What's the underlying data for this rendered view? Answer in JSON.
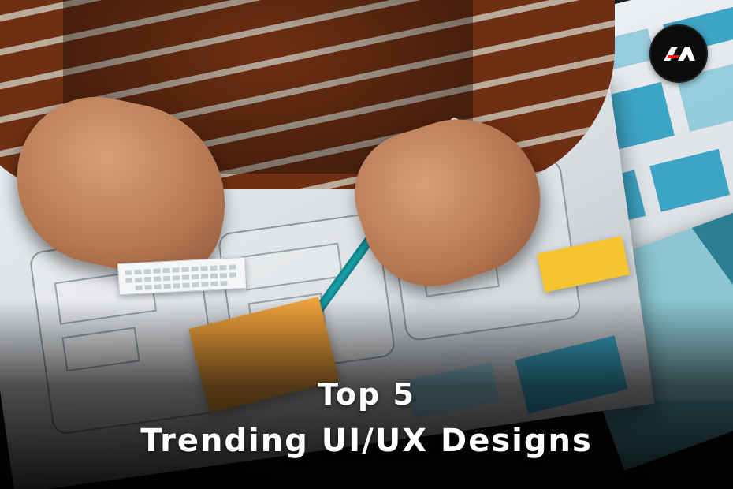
{
  "caption": {
    "line1": "Top 5",
    "line2": "Trending UI/UX Designs"
  },
  "logo": {
    "icon": "brand-logo-icon",
    "colors": {
      "background": "#0b0b0b",
      "white": "#ffffff",
      "accent": "#e2231a"
    }
  },
  "scene": {
    "paper_color": "#e9ecef",
    "wireframe_blue": "#2f9ec1",
    "sticky_orange": "#f0a23b",
    "sticky_yellow": "#f4c531",
    "pencil_teal": "#18a2a9",
    "sweater_orange": "#8a3b17"
  }
}
